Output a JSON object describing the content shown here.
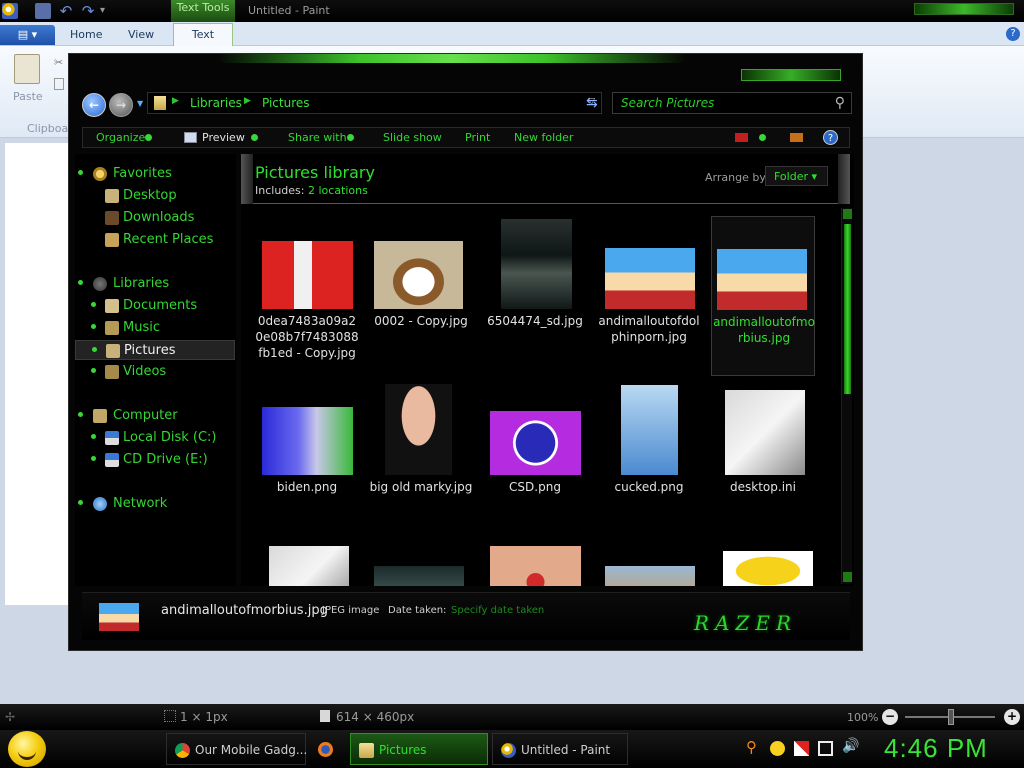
{
  "paint": {
    "title": "Untitled - Paint",
    "context_tab": "Text Tools",
    "qat": {
      "undo": "↶",
      "redo": "↷",
      "dropdown": "▾"
    },
    "ribbon": {
      "app_menu": "▤ ▾",
      "tabs": [
        "Home",
        "View",
        "Text"
      ],
      "help": "?",
      "paste_label": "Paste",
      "cut_glyph": "✂",
      "clipboard_group": "Clipboa"
    },
    "status": {
      "cursor_glyph": "✢",
      "selection_size": "1 × 1px",
      "canvas_size": "614 × 460px",
      "zoom": "100%",
      "zoom_out": "−",
      "zoom_in": "+"
    }
  },
  "explorer": {
    "nav_buttons": {
      "back": "←",
      "forward": "→",
      "history": "▼"
    },
    "address": {
      "breadcrumbs": [
        "Libraries",
        "Pictures"
      ],
      "chevron": "▶",
      "dropdown": "▽",
      "refresh_glyph": "⇆"
    },
    "search": {
      "placeholder": "Search Pictures",
      "glyph": "⚲"
    },
    "commands": {
      "organize": "Organize",
      "preview": "Preview",
      "share_with": "Share with",
      "slide_show": "Slide show",
      "print": "Print",
      "new_folder": "New folder",
      "help": "?"
    },
    "nav_pane": {
      "favorites": "Favorites",
      "desktop": "Desktop",
      "downloads": "Downloads",
      "recent_places": "Recent Places",
      "libraries": "Libraries",
      "documents": "Documents",
      "music": "Music",
      "pictures": "Pictures",
      "videos": "Videos",
      "computer": "Computer",
      "local_disk": "Local Disk (C:)",
      "cd_drive": "CD Drive (E:)",
      "network": "Network"
    },
    "library": {
      "title": "Pictures library",
      "includes_label": "Includes: ",
      "locations": "2 locations",
      "arrange_label": "Arrange by:",
      "arrange_value": "Folder ▾"
    },
    "files": [
      "0dea7483a09a20e08b7f7483088fb1ed - Copy.jpg",
      "0002 - Copy.jpg",
      "6504474_sd.jpg",
      "andimalloutofdolphinporn.jpg",
      "andimalloutofmorbius.jpg",
      "biden.png",
      "big old marky.jpg",
      "CSD.png",
      "cucked.png",
      "desktop.ini"
    ],
    "details": {
      "filename": "andimalloutofmorbius.jpg",
      "type": "JPEG image",
      "date_label": "Date taken:",
      "date_value": "Specify date taken",
      "logo": "RAZER"
    }
  },
  "taskbar": {
    "tasks": [
      "Our Mobile Gadg...",
      "",
      "Pictures",
      "Untitled - Paint"
    ],
    "tray_search_glyph": "⚲",
    "tray_volume_glyph": "🔊",
    "clock": "4:46 PM"
  },
  "colors": {
    "accent_green": "#2fe02f",
    "explorer_bg": "#050505",
    "ribbon_bg": "#dfe9f5"
  }
}
